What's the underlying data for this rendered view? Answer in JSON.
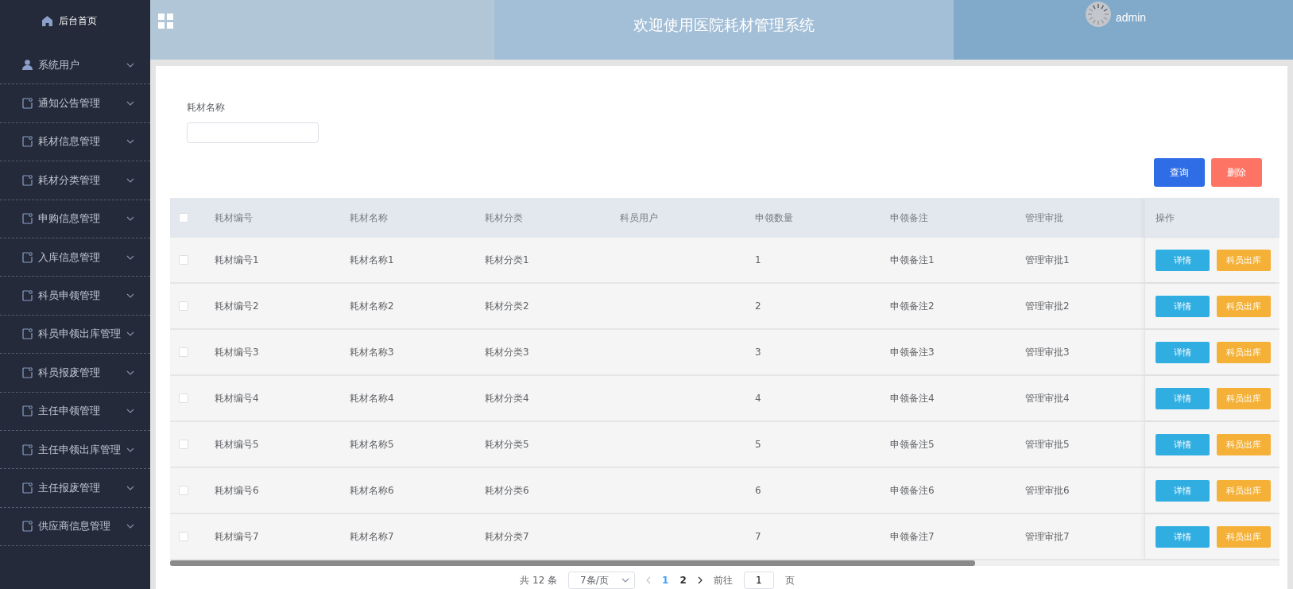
{
  "sidebar": {
    "home": "后台首页",
    "items": [
      {
        "label": "系统用户",
        "kind": "user"
      },
      {
        "label": "通知公告管理",
        "kind": "note"
      },
      {
        "label": "耗材信息管理",
        "kind": "note"
      },
      {
        "label": "耗材分类管理",
        "kind": "note"
      },
      {
        "label": "申购信息管理",
        "kind": "note"
      },
      {
        "label": "入库信息管理",
        "kind": "note"
      },
      {
        "label": "科员申领管理",
        "kind": "note"
      },
      {
        "label": "科员申领出库管理",
        "kind": "note"
      },
      {
        "label": "科员报废管理",
        "kind": "note"
      },
      {
        "label": "主任申领管理",
        "kind": "note"
      },
      {
        "label": "主任申领出库管理",
        "kind": "note"
      },
      {
        "label": "主任报废管理",
        "kind": "note"
      },
      {
        "label": "供应商信息管理",
        "kind": "note"
      }
    ]
  },
  "header": {
    "title": "欢迎使用医院耗材管理系统",
    "user": "admin"
  },
  "search": {
    "label": "耗材名称",
    "buttons": [
      {
        "label": "查询",
        "kind": "primary"
      },
      {
        "label": "删除",
        "kind": "danger"
      }
    ]
  },
  "table": {
    "header_checked": false,
    "columns": [
      "耗材编号",
      "耗材名称",
      "耗材分类",
      "科员用户",
      "申领数量",
      "申领备注",
      "管理审批",
      "操作"
    ],
    "rows": [
      {
        "checked": false,
        "cells": [
          "耗材编号1",
          "耗材名称1",
          "耗材分类1",
          null,
          "1",
          "申领备注1",
          "管理审批1"
        ],
        "actions": [
          {
            "label": "详情",
            "kind": "info"
          },
          {
            "label": "科员出库",
            "kind": "warning"
          }
        ]
      },
      {
        "checked": false,
        "cells": [
          "耗材编号2",
          "耗材名称2",
          "耗材分类2",
          null,
          "2",
          "申领备注2",
          "管理审批2"
        ],
        "actions": [
          {
            "label": "详情",
            "kind": "info"
          },
          {
            "label": "科员出库",
            "kind": "warning"
          }
        ]
      },
      {
        "checked": false,
        "cells": [
          "耗材编号3",
          "耗材名称3",
          "耗材分类3",
          null,
          "3",
          "申领备注3",
          "管理审批3"
        ],
        "actions": [
          {
            "label": "详情",
            "kind": "info"
          },
          {
            "label": "科员出库",
            "kind": "warning"
          }
        ]
      },
      {
        "checked": false,
        "cells": [
          "耗材编号4",
          "耗材名称4",
          "耗材分类4",
          null,
          "4",
          "申领备注4",
          "管理审批4"
        ],
        "actions": [
          {
            "label": "详情",
            "kind": "info"
          },
          {
            "label": "科员出库",
            "kind": "warning"
          }
        ]
      },
      {
        "checked": false,
        "cells": [
          "耗材编号5",
          "耗材名称5",
          "耗材分类5",
          null,
          "5",
          "申领备注5",
          "管理审批5"
        ],
        "actions": [
          {
            "label": "详情",
            "kind": "info"
          },
          {
            "label": "科员出库",
            "kind": "warning"
          }
        ]
      },
      {
        "checked": false,
        "cells": [
          "耗材编号6",
          "耗材名称6",
          "耗材分类6",
          null,
          "6",
          "申领备注6",
          "管理审批6"
        ],
        "actions": [
          {
            "label": "详情",
            "kind": "info"
          },
          {
            "label": "科员出库",
            "kind": "warning"
          }
        ]
      },
      {
        "checked": false,
        "cells": [
          "耗材编号7",
          "耗材名称7",
          "耗材分类7",
          null,
          "7",
          "申领备注7",
          "管理审批7"
        ],
        "actions": [
          {
            "label": "详情",
            "kind": "info"
          },
          {
            "label": "科员出库",
            "kind": "warning"
          }
        ]
      }
    ]
  },
  "pager": {
    "total": "共 12 条",
    "page_size": "7条/页",
    "pages": [
      {
        "label": "1",
        "selected": true
      },
      {
        "label": "2",
        "selected": false
      }
    ],
    "goto_label": "前往",
    "goto_value": "1",
    "goto_suffix": "页"
  }
}
